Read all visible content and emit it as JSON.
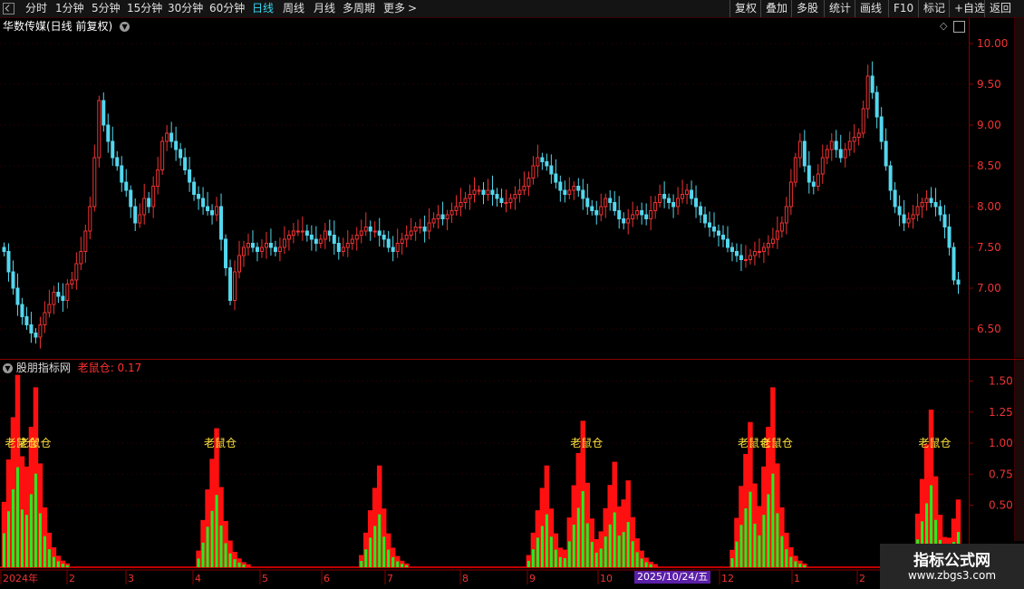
{
  "toolbar": {
    "periods": [
      "分时",
      "1分钟",
      "5分钟",
      "15分钟",
      "30分钟",
      "60分钟",
      "日线",
      "周线",
      "月线",
      "多周期",
      "更多"
    ],
    "active": "日线",
    "more_arrow": ">",
    "right_buttons": [
      "复权",
      "叠加",
      "多股",
      "统计",
      "画线",
      "F10",
      "标记",
      "+自选",
      "返回"
    ]
  },
  "main_chart": {
    "title": "华数传媒(日线 前复权)",
    "price_ticks": [
      "10.00",
      "9.50",
      "9.00",
      "8.50",
      "8.00",
      "7.50",
      "7.00",
      "6.50"
    ],
    "up_color": "#ee3333",
    "down_color": "#54d7ee"
  },
  "indicator": {
    "name": "股朋指标网",
    "label": "老鼠仓",
    "value": "0.17",
    "axis_ticks": [
      "1.50",
      "1.25",
      "1.00",
      "0.75",
      "0.50"
    ],
    "signal_text": "老鼠仓"
  },
  "x_axis": {
    "labels": [
      "2024年",
      "2",
      "3",
      "4",
      "5",
      "6",
      "7",
      "8",
      "9",
      "10",
      "12",
      "1",
      "2"
    ],
    "cursor_date": "2025/10/24/五"
  },
  "watermark": {
    "title": "指标公式网",
    "url": "www.zbgs3.com"
  },
  "chart_data": {
    "type": "candlestick",
    "title": "华数传媒(日线 前复权)",
    "ylim": [
      6.2,
      10.2
    ],
    "close_series": [
      7.45,
      7.2,
      7.0,
      6.8,
      6.65,
      6.55,
      6.45,
      6.4,
      6.55,
      6.7,
      6.8,
      6.95,
      6.9,
      6.85,
      7.05,
      7.1,
      7.3,
      7.45,
      7.7,
      8.0,
      8.6,
      9.3,
      9.0,
      8.8,
      8.6,
      8.5,
      8.3,
      8.2,
      8.0,
      7.8,
      7.9,
      8.1,
      8.0,
      8.25,
      8.45,
      8.8,
      8.9,
      8.8,
      8.7,
      8.6,
      8.45,
      8.3,
      8.15,
      8.1,
      8.0,
      7.95,
      7.9,
      8.0,
      7.6,
      7.25,
      6.85,
      7.2,
      7.4,
      7.5,
      7.55,
      7.5,
      7.45,
      7.5,
      7.55,
      7.5,
      7.45,
      7.5,
      7.6,
      7.65,
      7.7,
      7.7,
      7.7,
      7.65,
      7.6,
      7.55,
      7.6,
      7.7,
      7.65,
      7.55,
      7.45,
      7.5,
      7.55,
      7.6,
      7.65,
      7.7,
      7.75,
      7.7,
      7.7,
      7.65,
      7.6,
      7.5,
      7.45,
      7.55,
      7.6,
      7.65,
      7.7,
      7.75,
      7.75,
      7.7,
      7.8,
      7.85,
      7.9,
      7.85,
      7.9,
      7.95,
      8.0,
      8.05,
      8.1,
      8.15,
      8.2,
      8.2,
      8.15,
      8.2,
      8.15,
      8.1,
      8.05,
      8.05,
      8.1,
      8.15,
      8.2,
      8.25,
      8.35,
      8.5,
      8.6,
      8.55,
      8.5,
      8.4,
      8.3,
      8.2,
      8.15,
      8.2,
      8.25,
      8.2,
      8.1,
      8.0,
      7.95,
      7.9,
      8.0,
      8.1,
      8.05,
      7.95,
      7.85,
      7.8,
      7.85,
      7.9,
      7.95,
      7.9,
      7.85,
      7.95,
      8.05,
      8.15,
      8.1,
      8.05,
      8.0,
      8.1,
      8.15,
      8.2,
      8.1,
      8.0,
      7.9,
      7.8,
      7.75,
      7.7,
      7.65,
      7.6,
      7.5,
      7.45,
      7.4,
      7.35,
      7.35,
      7.4,
      7.45,
      7.45,
      7.5,
      7.55,
      7.6,
      7.7,
      7.8,
      8.0,
      8.3,
      8.6,
      8.8,
      8.5,
      8.3,
      8.25,
      8.4,
      8.6,
      8.7,
      8.8,
      8.7,
      8.6,
      8.7,
      8.8,
      8.85,
      8.9,
      9.2,
      9.6,
      9.4,
      9.1,
      8.8,
      8.5,
      8.2,
      8.0,
      7.9,
      7.8,
      7.85,
      7.9,
      8.0,
      8.05,
      8.1,
      8.05,
      8.0,
      7.9,
      7.75,
      7.5,
      7.1,
      7.05
    ],
    "indicator_peaks": [
      {
        "index": 3,
        "value": 1.55
      },
      {
        "index": 7,
        "value": 1.45
      },
      {
        "index": 47,
        "value": 1.12
      },
      {
        "index": 83,
        "value": 0.82
      },
      {
        "index": 120,
        "value": 0.82
      },
      {
        "index": 128,
        "value": 1.18
      },
      {
        "index": 135,
        "value": 0.85
      },
      {
        "index": 138,
        "value": 0.7
      },
      {
        "index": 165,
        "value": 1.17
      },
      {
        "index": 170,
        "value": 1.45
      },
      {
        "index": 205,
        "value": 1.27
      },
      {
        "index": 212,
        "value": 0.7
      }
    ],
    "signal_positions": [
      3,
      6,
      47,
      128,
      165,
      170,
      205
    ]
  }
}
